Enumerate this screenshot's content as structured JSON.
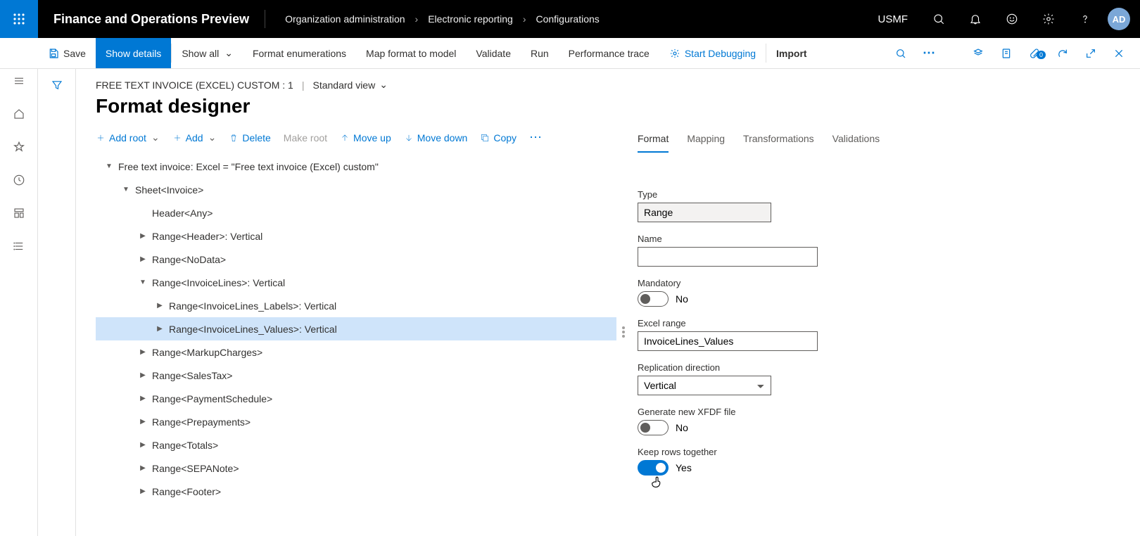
{
  "header": {
    "app_title": "Finance and Operations Preview",
    "breadcrumbs": [
      "Organization administration",
      "Electronic reporting",
      "Configurations"
    ],
    "company": "USMF",
    "avatar": "AD"
  },
  "cmdbar": {
    "save": "Save",
    "show_details": "Show details",
    "show_all": "Show all",
    "format_enum": "Format enumerations",
    "map_format": "Map format to model",
    "validate": "Validate",
    "run": "Run",
    "perf_trace": "Performance trace",
    "start_debug": "Start Debugging",
    "import": "Import",
    "attach_badge": "0"
  },
  "page": {
    "context": "FREE TEXT INVOICE (EXCEL) CUSTOM : 1",
    "view": "Standard view",
    "title": "Format designer"
  },
  "tree_toolbar": {
    "add_root": "Add root",
    "add": "Add",
    "delete": "Delete",
    "make_root": "Make root",
    "move_up": "Move up",
    "move_down": "Move down",
    "copy": "Copy"
  },
  "tree": [
    {
      "depth": 0,
      "expand": "open",
      "label": "Free text invoice: Excel = \"Free text invoice (Excel) custom\""
    },
    {
      "depth": 1,
      "expand": "open",
      "label": "Sheet<Invoice>"
    },
    {
      "depth": 2,
      "expand": "none",
      "label": "Header<Any>"
    },
    {
      "depth": 2,
      "expand": "closed",
      "label": "Range<Header>: Vertical"
    },
    {
      "depth": 2,
      "expand": "closed",
      "label": "Range<NoData>"
    },
    {
      "depth": 2,
      "expand": "open",
      "label": "Range<InvoiceLines>: Vertical"
    },
    {
      "depth": 3,
      "expand": "closed",
      "label": "Range<InvoiceLines_Labels>: Vertical"
    },
    {
      "depth": 3,
      "expand": "closed",
      "label": "Range<InvoiceLines_Values>: Vertical",
      "selected": true
    },
    {
      "depth": 2,
      "expand": "closed",
      "label": "Range<MarkupCharges>"
    },
    {
      "depth": 2,
      "expand": "closed",
      "label": "Range<SalesTax>"
    },
    {
      "depth": 2,
      "expand": "closed",
      "label": "Range<PaymentSchedule>"
    },
    {
      "depth": 2,
      "expand": "closed",
      "label": "Range<Prepayments>"
    },
    {
      "depth": 2,
      "expand": "closed",
      "label": "Range<Totals>"
    },
    {
      "depth": 2,
      "expand": "closed",
      "label": "Range<SEPANote>"
    },
    {
      "depth": 2,
      "expand": "closed",
      "label": "Range<Footer>"
    }
  ],
  "tabs": {
    "format": "Format",
    "mapping": "Mapping",
    "transformations": "Transformations",
    "validations": "Validations"
  },
  "form": {
    "type_label": "Type",
    "type_value": "Range",
    "name_label": "Name",
    "name_value": "",
    "mandatory_label": "Mandatory",
    "mandatory_value": "No",
    "excel_range_label": "Excel range",
    "excel_range_value": "InvoiceLines_Values",
    "replication_label": "Replication direction",
    "replication_value": "Vertical",
    "xfdf_label": "Generate new XFDF file",
    "xfdf_value": "No",
    "keep_rows_label": "Keep rows together",
    "keep_rows_value": "Yes"
  }
}
